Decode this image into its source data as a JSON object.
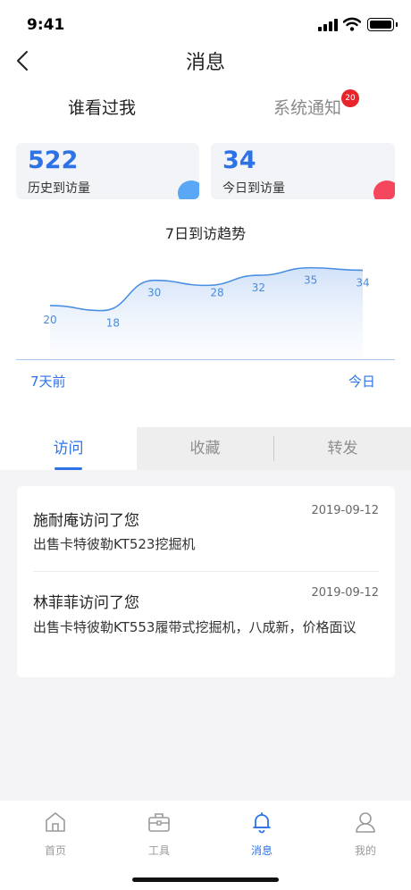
{
  "status_bar": {
    "time": "9:41"
  },
  "header": {
    "title": "消息"
  },
  "segments": {
    "visitors": "谁看过我",
    "notifications": "系统通知",
    "notifications_badge": "20"
  },
  "stats": {
    "history": {
      "value": "522",
      "label": "历史到访量"
    },
    "today": {
      "value": "34",
      "label": "今日到访量"
    }
  },
  "trend": {
    "start_label": "7天前",
    "end_label": "今日"
  },
  "chart_data": {
    "type": "area",
    "title": "7日到访趋势",
    "x": [
      1,
      2,
      3,
      4,
      5,
      6,
      7
    ],
    "values": [
      20,
      18,
      30,
      28,
      32,
      35,
      34
    ],
    "series": [
      {
        "values": [
          20,
          18,
          30,
          28,
          32,
          35,
          34
        ]
      }
    ],
    "data_labels": [
      "20",
      "18",
      "30",
      "28",
      "32",
      "35",
      "34"
    ],
    "ylim": [
      0,
      45
    ],
    "grid": false,
    "color": "#3a83e0"
  },
  "tabs": [
    {
      "label": "访问",
      "active": true
    },
    {
      "label": "收藏",
      "active": false
    },
    {
      "label": "转发",
      "active": false
    }
  ],
  "visits": [
    {
      "who": "施耐庵访问了您",
      "date": "2019-09-12",
      "desc": "出售卡特彼勒KT523挖掘机"
    },
    {
      "who": "林菲菲访问了您",
      "date": "2019-09-12",
      "desc": "出售卡特彼勒KT553履带式挖掘机，八成新，价格面议"
    }
  ],
  "tabbar": [
    {
      "label": "首页",
      "icon": "home-icon"
    },
    {
      "label": "工具",
      "icon": "toolbox-icon"
    },
    {
      "label": "消息",
      "icon": "bell-icon",
      "active": true
    },
    {
      "label": "我的",
      "icon": "user-icon"
    }
  ],
  "colors": {
    "accent": "#2d73e6",
    "badge": "#e8242b",
    "history_blob": "#5aa8f5",
    "today_blob": "#f4475e"
  }
}
